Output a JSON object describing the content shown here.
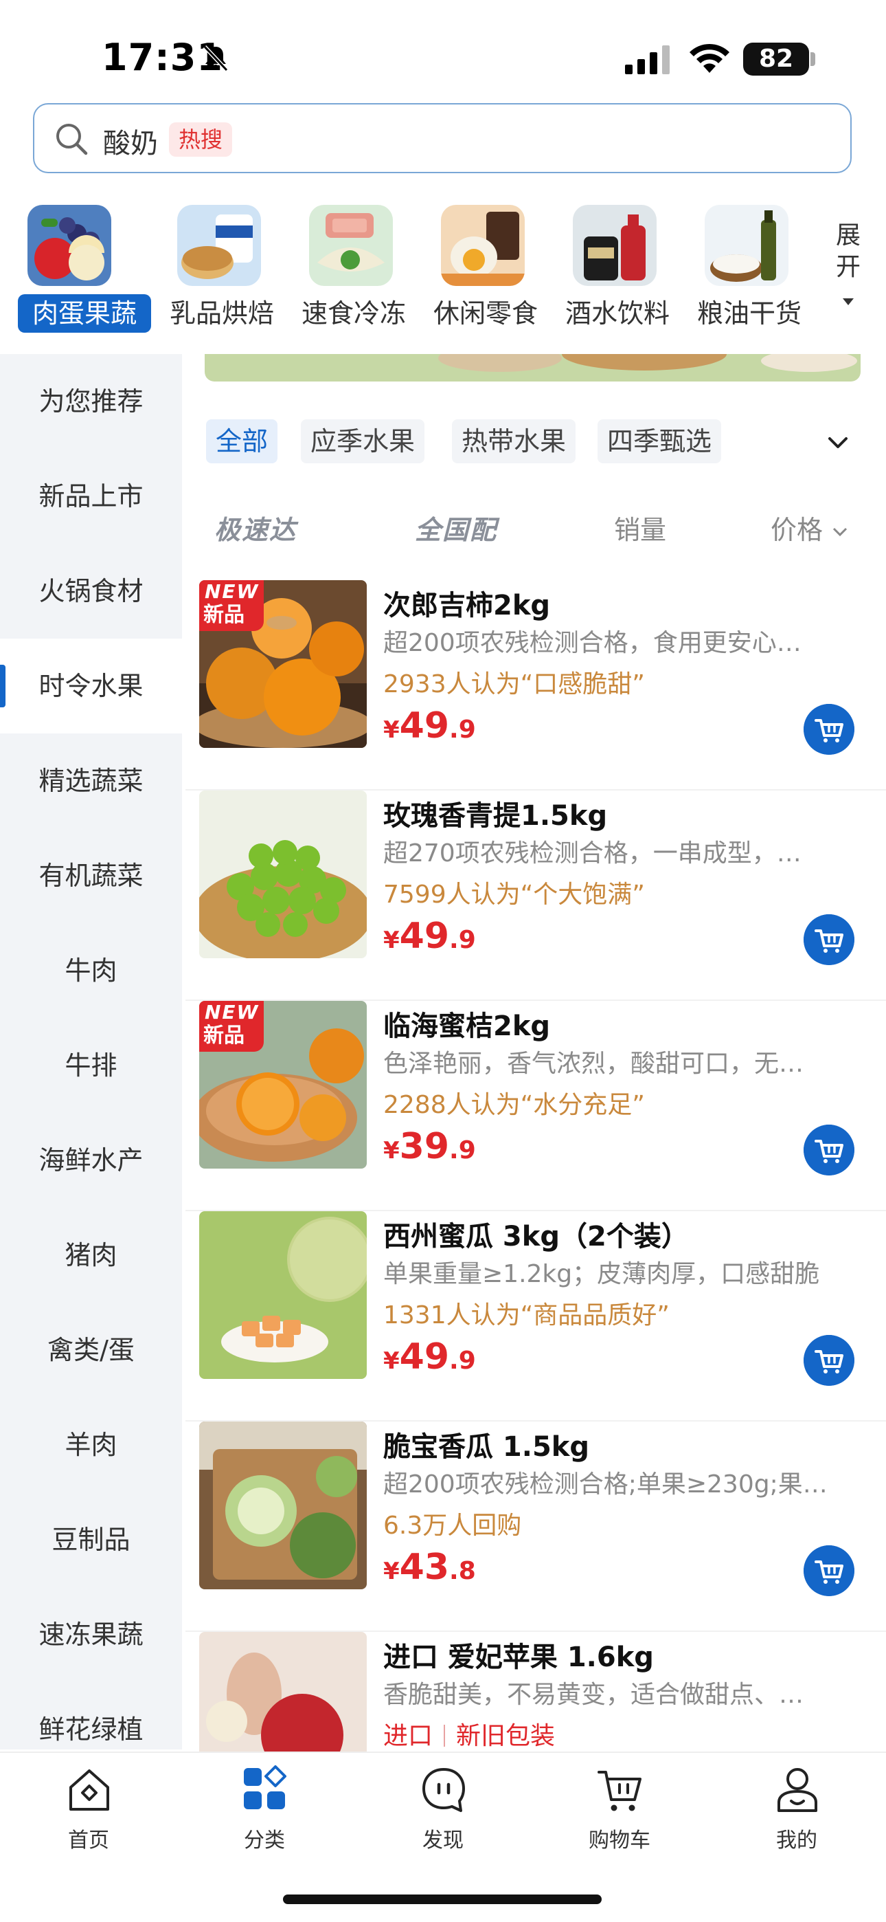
{
  "status_bar": {
    "time": "17:31",
    "battery": "82"
  },
  "search": {
    "query": "酸奶",
    "hot_badge": "热搜"
  },
  "top_categories": [
    {
      "label": "肉蛋果蔬",
      "active": true
    },
    {
      "label": "乳品烘焙",
      "active": false
    },
    {
      "label": "速食冷冻",
      "active": false
    },
    {
      "label": "休闲零食",
      "active": false
    },
    {
      "label": "酒水饮料",
      "active": false
    },
    {
      "label": "粮油干货",
      "active": false
    }
  ],
  "expand_label": [
    "展",
    "开"
  ],
  "sidebar": {
    "items": [
      "为您推荐",
      "新品上市",
      "火锅食材",
      "时令水果",
      "精选蔬菜",
      "有机蔬菜",
      "牛肉",
      "牛排",
      "海鲜水产",
      "猪肉",
      "禽类/蛋",
      "羊肉",
      "豆制品",
      "速冻果蔬",
      "鲜花绿植"
    ],
    "active_index": 3
  },
  "filter_chips": [
    {
      "label": "全部",
      "active": true
    },
    {
      "label": "应季水果",
      "active": false
    },
    {
      "label": "热带水果",
      "active": false
    },
    {
      "label": "四季甄选",
      "active": false
    }
  ],
  "sort": {
    "express": "极速达",
    "nationwide": "全国配",
    "sales": "销量",
    "price": "价格"
  },
  "products": [
    {
      "title": "次郎吉柿2kg",
      "desc": "超200项农残检测合格，食用更安心…",
      "social": "2933人认为“口感脆甜”",
      "price_currency": "¥",
      "price_int": "49",
      "price_dec": ".9",
      "new_badge": true
    },
    {
      "title": "玫瑰香青提1.5kg",
      "desc": "超270项农残检测合格，一串成型，…",
      "social": "7599人认为“个大饱满”",
      "price_currency": "¥",
      "price_int": "49",
      "price_dec": ".9",
      "new_badge": false
    },
    {
      "title": "临海蜜桔2kg",
      "desc": "色泽艳丽，香气浓烈，酸甜可口，无…",
      "social": "2288人认为“水分充足”",
      "price_currency": "¥",
      "price_int": "39",
      "price_dec": ".9",
      "new_badge": true
    },
    {
      "title": "西州蜜瓜 3kg（2个装）",
      "desc": "单果重量≥1.2kg；皮薄肉厚，口感甜脆",
      "social": "1331人认为“商品品质好”",
      "price_currency": "¥",
      "price_int": "49",
      "price_dec": ".9",
      "new_badge": false
    },
    {
      "title": "脆宝香瓜 1.5kg",
      "desc": "超200项农残检测合格;单果≥230g;果…",
      "social": "6.3万人回购",
      "price_currency": "¥",
      "price_int": "43",
      "price_dec": ".8",
      "new_badge": false
    },
    {
      "title": "进口 爱妃苹果 1.6kg",
      "desc": "香脆甜美，不易黄变，适合做甜点、…",
      "tags": [
        "进口",
        "新旧包装"
      ]
    }
  ],
  "new_badge": {
    "line1": "NEW",
    "line2": "新品"
  },
  "tabbar": [
    {
      "label": "首页",
      "icon": "home-icon",
      "active": false
    },
    {
      "label": "分类",
      "icon": "category-icon",
      "active": true
    },
    {
      "label": "发现",
      "icon": "discover-icon",
      "active": false
    },
    {
      "label": "购物车",
      "icon": "cart-icon",
      "active": false
    },
    {
      "label": "我的",
      "icon": "profile-icon",
      "active": false
    }
  ],
  "colors": {
    "accent": "#1466c8",
    "price": "#e0272b",
    "social": "#c9883c",
    "sidebar_bg": "#f2f4f7"
  }
}
